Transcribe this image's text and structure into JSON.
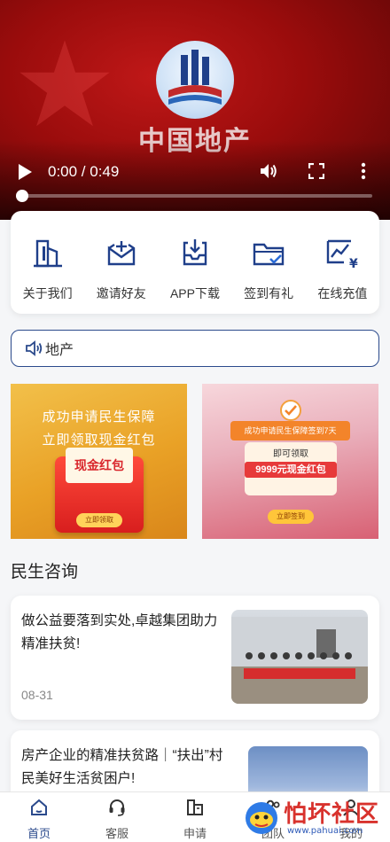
{
  "video": {
    "logo_text": "中国地产",
    "time": "0:00 / 0:49",
    "progress": 0.0
  },
  "menu": [
    {
      "label": "关于我们",
      "icon": "building-icon"
    },
    {
      "label": "邀请好友",
      "icon": "mail-plus-icon"
    },
    {
      "label": "APP下载",
      "icon": "download-tray-icon"
    },
    {
      "label": "签到有礼",
      "icon": "folder-check-icon"
    },
    {
      "label": "在线充值",
      "icon": "yuan-chart-icon"
    }
  ],
  "notice": {
    "text": "地产",
    "icon": "speaker-icon"
  },
  "banners": {
    "left": {
      "line1": "成功申请民生保障",
      "line2": "立即领取现金红包",
      "card": "现金红包",
      "button": "立即领取"
    },
    "right": {
      "ribbon": "成功申请民生保障签到7天",
      "line1": "即可领取",
      "line2": "9999元现金红包",
      "button": "立即签到"
    }
  },
  "section_title": "民生咨询",
  "news": [
    {
      "title": "做公益要落到实处,卓越集团助力精准扶贫!",
      "date": "08-31"
    },
    {
      "title": "房产企业的精准扶贫路｜“扶出”村民美好生活贫困户!",
      "date": ""
    }
  ],
  "nav": [
    {
      "label": "首页",
      "icon": "home-icon",
      "active": true
    },
    {
      "label": "客服",
      "icon": "headset-icon",
      "active": false
    },
    {
      "label": "申请",
      "icon": "document-icon",
      "active": false
    },
    {
      "label": "团队",
      "icon": "team-icon",
      "active": false
    },
    {
      "label": "我的",
      "icon": "user-icon",
      "active": false
    }
  ],
  "watermark": {
    "text": "怕坏社区",
    "url": "www.pahuai.com"
  },
  "colors": {
    "accent": "#2b4a8c",
    "video_red": "#b01414"
  }
}
